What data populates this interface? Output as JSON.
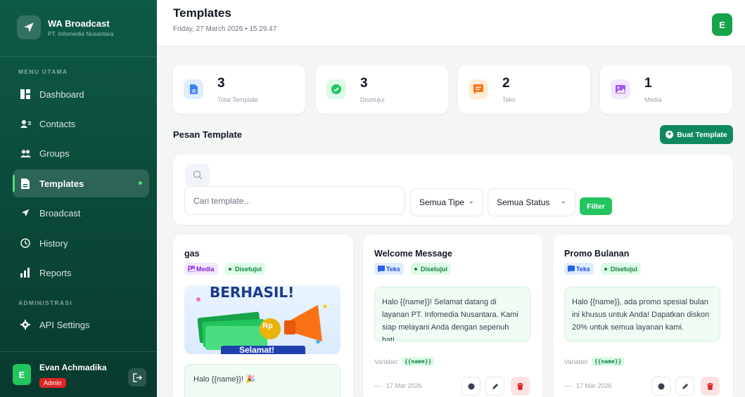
{
  "brand": {
    "title": "WA Broadcast",
    "subtitle": "PT. Infomedia Nusantara"
  },
  "sidebar": {
    "section_main": "MENU UTAMA",
    "section_admin": "ADMINISTRASI",
    "items": [
      {
        "label": "Dashboard",
        "icon": "dashboard-icon"
      },
      {
        "label": "Contacts",
        "icon": "contacts-icon"
      },
      {
        "label": "Groups",
        "icon": "groups-icon"
      },
      {
        "label": "Templates",
        "icon": "templates-icon",
        "active": true
      },
      {
        "label": "Broadcast",
        "icon": "send-icon"
      },
      {
        "label": "History",
        "icon": "history-icon"
      },
      {
        "label": "Reports",
        "icon": "reports-icon"
      }
    ],
    "admin_items": [
      {
        "label": "API Settings",
        "icon": "gear-icon"
      }
    ]
  },
  "user": {
    "initial": "E",
    "name": "Evan Achmadika",
    "role": "Admin"
  },
  "header": {
    "title": "Templates",
    "date": "Friday, 27 March 2026 • 15.29.47",
    "avatar_initial": "E"
  },
  "stats": [
    {
      "value": "3",
      "label": "Total Template",
      "color": "#3b82f6"
    },
    {
      "value": "3",
      "label": "Disetujui",
      "color": "#22c55e"
    },
    {
      "value": "2",
      "label": "Teks",
      "color": "#f97316"
    },
    {
      "value": "1",
      "label": "Media",
      "color": "#a855f7"
    }
  ],
  "section": {
    "title": "Pesan Template",
    "create_label": "Buat Template"
  },
  "filter": {
    "search_placeholder": "Cari template...",
    "type_value": "Semua Tipe",
    "status_value": "Semua Status",
    "filter_label": "Filter"
  },
  "templates": [
    {
      "name": "gas",
      "type": "Media",
      "status": "Disetujui",
      "media_text_top": "BERHASIL!",
      "media_text_bottom": "Selamat!",
      "media_coin": "Rp",
      "caption": "Halo {{name}}! 🎉"
    },
    {
      "name": "Welcome Message",
      "type": "Teks",
      "status": "Disetujui",
      "body": "Halo {{name}}! Selamat datang di layanan PT. Infomedia Nusantara. Kami siap melayani Anda dengan sepenuh hati.",
      "var_label": "Variabel:",
      "var_chip": "{{name}}",
      "date": "— · 17 Mar 2026"
    },
    {
      "name": "Promo Bulanan",
      "type": "Teks",
      "status": "Disetujui",
      "body": "Halo {{name}}, ada promo spesial bulan ini khusus untuk Anda! Dapatkan diskon 20% untuk semua layanan kami.",
      "var_label": "Variabel:",
      "var_chip": "{{name}}",
      "date": "— · 17 Mar 2026"
    }
  ]
}
